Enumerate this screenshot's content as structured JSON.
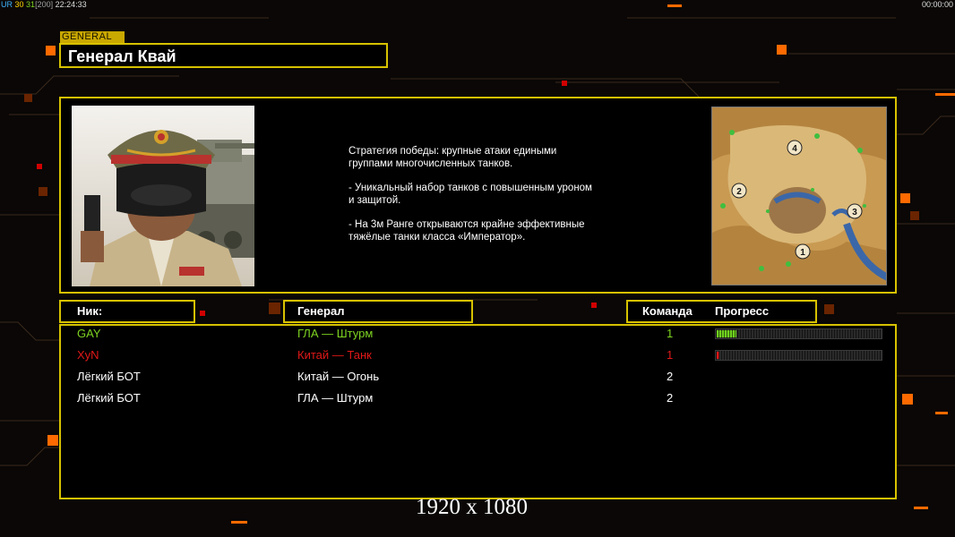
{
  "hud": {
    "fps_label": "UR",
    "fps_a": "30",
    "fps_b": "31",
    "fps_c": "[200]",
    "time": "22:24:33",
    "clock": "00:00:00"
  },
  "general_tag": "GENERAL",
  "general_name": "Генерал Квай",
  "strategy": {
    "line1": "Стратегия победы: крупные атаки едиными\n группами многочисленных танков.",
    "line2": "- Уникальный набор танков с повышенным уроном\n и защитой.",
    "line3": "- На 3м Ранге открываются крайне эффективные\n тяжёлые танки класса «Император»."
  },
  "map": {
    "spawns": [
      "1",
      "2",
      "3",
      "4"
    ]
  },
  "headers": {
    "nick": "Ник:",
    "general": "Генерал",
    "team": "Команда",
    "progress": "Прогресс"
  },
  "players": [
    {
      "nick": "GAY",
      "general": "ГЛА — Штурм",
      "team": "1",
      "color": "#7ed321",
      "progress": 0.12
    },
    {
      "nick": "XyN",
      "general": "Китай — Танк",
      "team": "1",
      "color": "#e01818",
      "progress": 0.02
    },
    {
      "nick": "Лёгкий БОТ",
      "general": "Китай — Огонь",
      "team": "2",
      "color": "#ffffff",
      "progress": null
    },
    {
      "nick": "Лёгкий БОТ",
      "general": "ГЛА — Штурм",
      "team": "2",
      "color": "#ffffff",
      "progress": null
    }
  ],
  "resolution": "1920 x 1080",
  "colors": {
    "frame": "#d7c200",
    "accent": "#ff6a00"
  }
}
